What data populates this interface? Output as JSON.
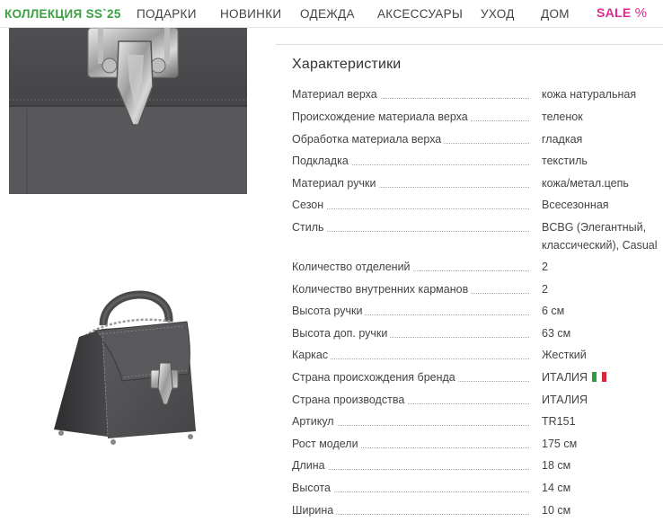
{
  "nav": {
    "brand": "КОЛЛЕКЦИЯ SS`25",
    "items": [
      "ПОДАРКИ",
      "НОВИНКИ",
      "ОДЕЖДА",
      "АКСЕССУАРЫ",
      "УХОД",
      "ДОМ"
    ],
    "sale_text": "SALE",
    "sale_symbol": "%"
  },
  "specs": {
    "title": "Характеристики",
    "rows": [
      {
        "label": "Материал верха",
        "value": "кожа натуральная"
      },
      {
        "label": "Происхождение материала верха",
        "value": "теленок"
      },
      {
        "label": "Обработка материала верха",
        "value": "гладкая"
      },
      {
        "label": "Подкладка",
        "value": "текстиль"
      },
      {
        "label": "Материал ручки",
        "value": "кожа/метал.цепь"
      },
      {
        "label": "Сезон",
        "value": "Всесезонная"
      },
      {
        "label": "Стиль",
        "value": "BCBG (Элегантный,",
        "value2": "классический), Casual"
      },
      {
        "label": "Количество отделений",
        "value": "2"
      },
      {
        "label": "Количество внутренних карманов",
        "value": "2"
      },
      {
        "label": "Высота ручки",
        "value": "6 см"
      },
      {
        "label": "Высота доп. ручки",
        "value": "63 см"
      },
      {
        "label": "Каркас",
        "value": "Жесткий"
      },
      {
        "label": "Страна происхождения бренда",
        "value": "ИТАЛИЯ"
      },
      {
        "label": "Страна производства",
        "value": "ИТАЛИЯ"
      },
      {
        "label": "Артикул",
        "value": "TR151"
      },
      {
        "label": "Рост модели",
        "value": "175 см"
      },
      {
        "label": "Длина",
        "value": "18 см"
      },
      {
        "label": "Высота",
        "value": "14 см"
      },
      {
        "label": "Ширина",
        "value": "10 см"
      }
    ]
  },
  "colors": {
    "brand_green": "#3aa142",
    "sale_pink": "#e0298f",
    "bag_gray": "#4f4f52"
  }
}
